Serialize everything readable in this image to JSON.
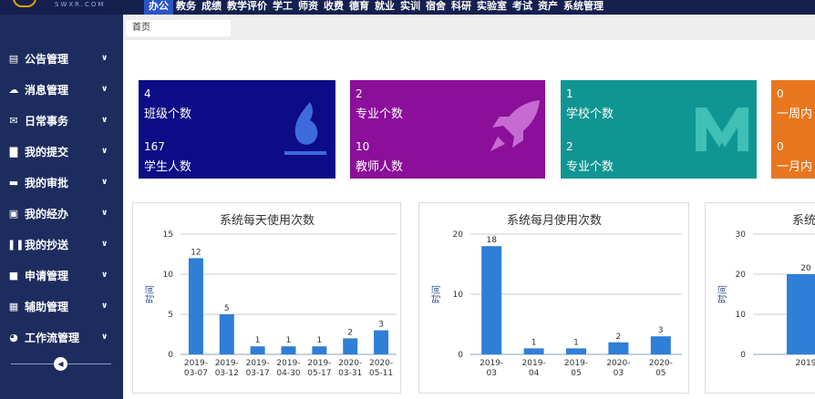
{
  "header": {
    "logo_text": "SWXR.COM",
    "menu": [
      "办公",
      "教务",
      "成绩",
      "教学评价",
      "学工",
      "师资",
      "收费",
      "德育",
      "就业",
      "实训",
      "宿舍",
      "科研",
      "实验室",
      "考试",
      "资产",
      "系统管理"
    ],
    "active_menu": "办公"
  },
  "sidebar": {
    "items": [
      {
        "icon": "notice-icon",
        "label": "公告管理"
      },
      {
        "icon": "cloud-icon",
        "label": "消息管理"
      },
      {
        "icon": "mail-icon",
        "label": "日常事务"
      },
      {
        "icon": "file-icon",
        "label": "我的提交"
      },
      {
        "icon": "folder-icon",
        "label": "我的审批"
      },
      {
        "icon": "handle-icon",
        "label": "我的经办"
      },
      {
        "icon": "copy-icon",
        "label": "我的抄送"
      },
      {
        "icon": "apply-icon",
        "label": "申请管理"
      },
      {
        "icon": "grid-icon",
        "label": "辅助管理"
      },
      {
        "icon": "pie-icon",
        "label": "工作流管理"
      }
    ]
  },
  "breadcrumb": "首页",
  "cards": [
    {
      "color": "#0c0c86",
      "icon": "flame-icon",
      "v1": "4",
      "l1": "班级个数",
      "v2": "167",
      "l2": "学生人数"
    },
    {
      "color": "#8b0f99",
      "icon": "rocket-icon",
      "v1": "2",
      "l1": "专业个数",
      "v2": "10",
      "l2": "教师人数"
    },
    {
      "color": "#109692",
      "icon": "m-logo-icon",
      "v1": "1",
      "l1": "学校个数",
      "v2": "2",
      "l2": "专业个数"
    },
    {
      "color": "#e8761e",
      "icon": "",
      "v1": "0",
      "l1": "一周内",
      "v2": "0",
      "l2": "一月内"
    }
  ],
  "chart_data": [
    {
      "type": "bar",
      "title": "系统每天使用次数",
      "ylabel": "时间",
      "categories": [
        "2019-03-07",
        "2019-03-12",
        "2019-03-17",
        "2019-04-30",
        "2019-05-17",
        "2020-03-31",
        "2020-05-11"
      ],
      "values": [
        12,
        5,
        1,
        1,
        1,
        2,
        3
      ],
      "ylim": [
        0,
        15
      ],
      "yticks": [
        0,
        5,
        10,
        15
      ],
      "color": "#2f7ed8",
      "grid": true
    },
    {
      "type": "bar",
      "title": "系统每月使用次数",
      "ylabel": "时间",
      "categories": [
        "2019-03",
        "2019-04",
        "2019-05",
        "2020-03",
        "2020-05"
      ],
      "values": [
        18,
        1,
        1,
        2,
        3
      ],
      "ylim": [
        0,
        20
      ],
      "yticks": [
        0,
        10,
        20
      ],
      "color": "#2f7ed8",
      "grid": true
    },
    {
      "type": "bar",
      "title": "系统",
      "ylabel": "时间",
      "categories": [
        "2019"
      ],
      "values": [
        20
      ],
      "ylim": [
        0,
        30
      ],
      "yticks": [
        0,
        10,
        20,
        30
      ],
      "color": "#2f7ed8",
      "grid": true
    }
  ]
}
